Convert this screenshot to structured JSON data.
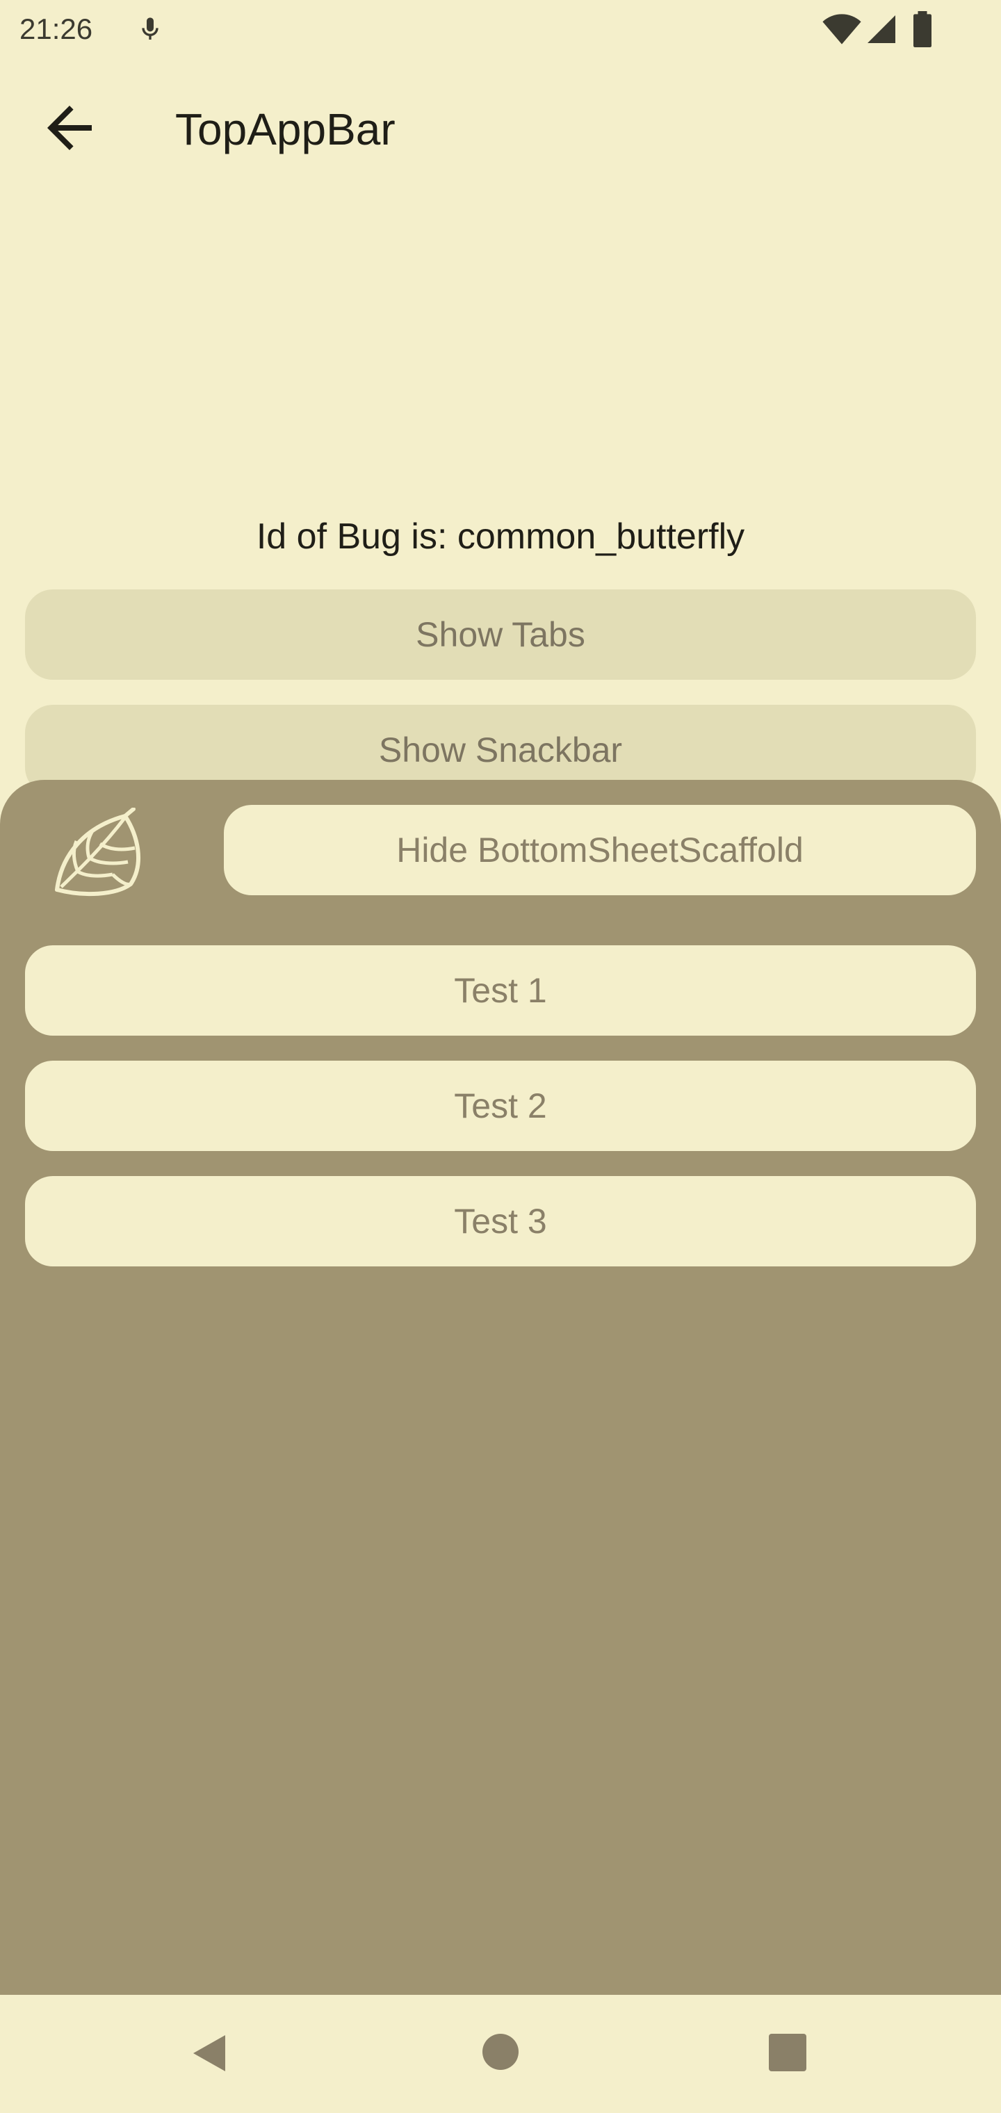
{
  "status_bar": {
    "time": "21:26",
    "icons": [
      "mic-icon",
      "wifi-icon",
      "signal-icon",
      "battery-icon"
    ]
  },
  "top_app_bar": {
    "title": "TopAppBar",
    "back_icon": "arrow-back-icon"
  },
  "main": {
    "bug_id_text": "Id of Bug is: common_butterfly",
    "show_tabs_label": "Show Tabs",
    "show_snackbar_label": "Show Snackbar"
  },
  "bottom_sheet": {
    "leaf_icon": "leaf-icon",
    "hide_label": "Hide BottomSheetScaffold",
    "test_buttons": [
      "Test 1",
      "Test 2",
      "Test 3"
    ]
  },
  "nav_bar": {
    "icons": [
      "nav-back-icon",
      "nav-home-icon",
      "nav-recents-icon"
    ]
  },
  "colors": {
    "background": "#F4EFCB",
    "sheet": "#A09471",
    "muted_button": "#E2DDB6",
    "button_text": "#7D7561",
    "title_text": "#1F1E17"
  }
}
